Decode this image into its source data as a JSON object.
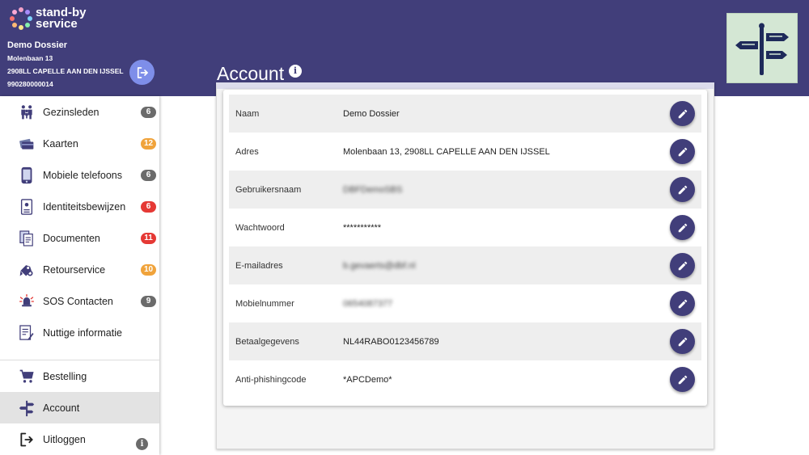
{
  "brand": {
    "line1": "stand-by",
    "line2": "service"
  },
  "dossier": {
    "name": "Demo Dossier",
    "street": "Molenbaan 13",
    "city": "2908LL CAPELLE AAN DEN IJSSEL",
    "number": "990280000014"
  },
  "page_title": "Account",
  "title_info": "i",
  "sidebar": {
    "items": [
      {
        "label": "Gezinsleden",
        "icon": "family-icon",
        "badge": "6",
        "badge_color": "#6b6b6b"
      },
      {
        "label": "Kaarten",
        "icon": "cards-icon",
        "badge": "12",
        "badge_color": "#f0a33b"
      },
      {
        "label": "Mobiele telefoons",
        "icon": "phone-icon",
        "badge": "6",
        "badge_color": "#6b6b6b"
      },
      {
        "label": "Identiteitsbewijzen",
        "icon": "id-card-icon",
        "badge": "6",
        "badge_color": "#e53935"
      },
      {
        "label": "Documenten",
        "icon": "documents-icon",
        "badge": "11",
        "badge_color": "#e53935"
      },
      {
        "label": "Retourservice",
        "icon": "keys-icon",
        "badge": "10",
        "badge_color": "#f0a33b"
      },
      {
        "label": "SOS Contacten",
        "icon": "alarm-bell-icon",
        "badge": "9",
        "badge_color": "#6b6b6b"
      },
      {
        "label": "Nuttige informatie",
        "icon": "info-document-icon"
      }
    ],
    "bottom": [
      {
        "label": "Bestelling",
        "icon": "cart-icon"
      },
      {
        "label": "Account",
        "icon": "signpost-icon",
        "active": true
      },
      {
        "label": "Uitloggen",
        "icon": "logout-icon"
      }
    ],
    "info": "i"
  },
  "account": {
    "rows": [
      {
        "label": "Naam",
        "value": "Demo Dossier"
      },
      {
        "label": "Adres",
        "value": "Molenbaan 13, 2908LL CAPELLE AAN DEN IJSSEL"
      },
      {
        "label": "Gebruikersnaam",
        "value": "DBFDemoSBS",
        "blurred": true
      },
      {
        "label": "Wachtwoord",
        "value": "***********"
      },
      {
        "label": "E-mailadres",
        "value": "b.gevaerts@dbf.nl",
        "blurred": true
      },
      {
        "label": "Mobielnummer",
        "value": "0654087377",
        "blurred": true
      },
      {
        "label": "Betaalgegevens",
        "value": "NL44RABO0123456789"
      },
      {
        "label": "Anti-phishingcode",
        "value": "*APCDemo*"
      }
    ]
  },
  "colors": {
    "header": "#413e7a",
    "accent": "#7e8ee9",
    "signpost_bg": "#d4e7d4"
  }
}
